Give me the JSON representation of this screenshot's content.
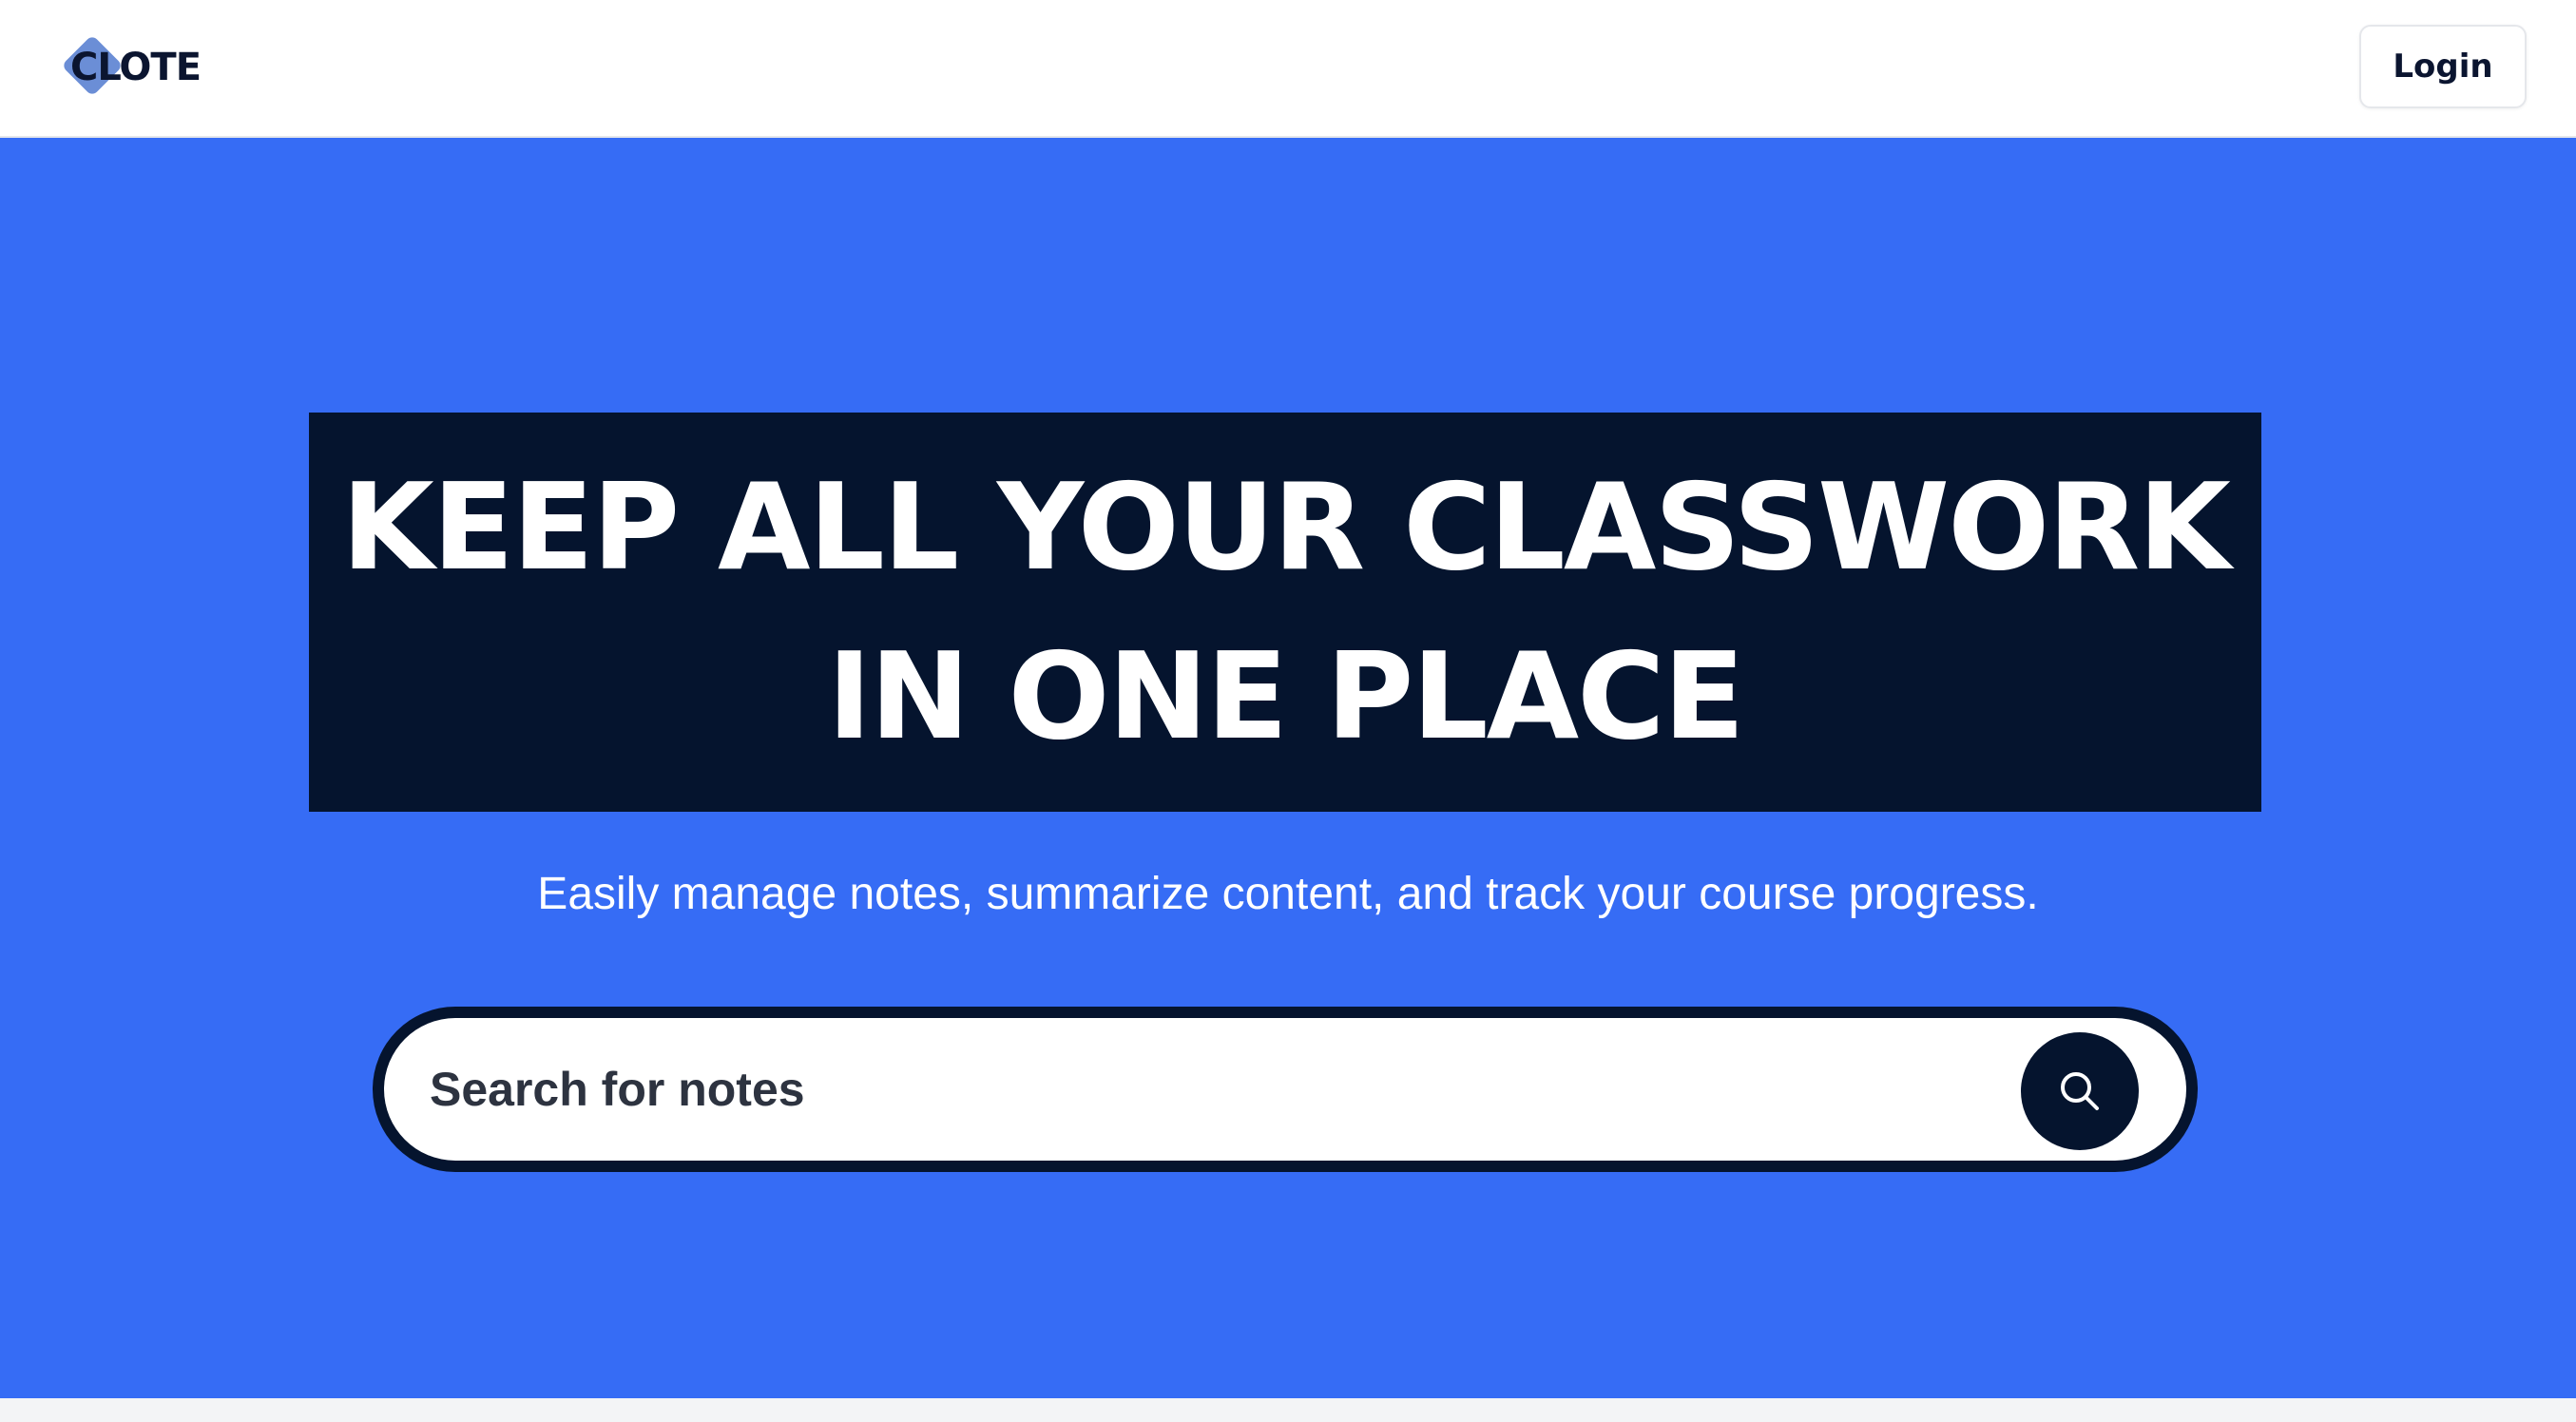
{
  "header": {
    "logo_text": "CLOTE",
    "login_label": "Login"
  },
  "hero": {
    "headline_line1": "KEEP ALL YOUR CLASSWORK",
    "headline_line2": "IN ONE PLACE",
    "subtitle": "Easily manage notes, summarize content, and track your course progress."
  },
  "search": {
    "placeholder": "Search for notes",
    "value": "",
    "icon": "search-icon"
  },
  "colors": {
    "hero_background": "#366cf5",
    "headline_box": "#05142e",
    "logo_accent": "#6b8ed6"
  }
}
